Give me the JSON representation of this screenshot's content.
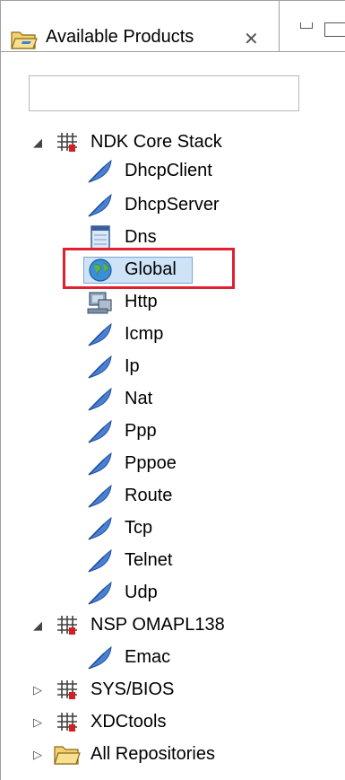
{
  "tab": {
    "title": "Available Products",
    "close_glyph": "✕",
    "icon": "folder-open-icon"
  },
  "view_controls": {
    "minimize_icon": "minimize-icon",
    "maximize_icon": "maximize-icon"
  },
  "search": {
    "placeholder": "",
    "value": ""
  },
  "tree": [
    {
      "label": "NDK Core Stack",
      "expanded": true,
      "icon": "package-icon",
      "children": [
        {
          "label": "DhcpClient",
          "icon": "feather-icon"
        },
        {
          "label": "DhcpServer",
          "icon": "feather-icon"
        },
        {
          "label": "Dns",
          "icon": "document-icon"
        },
        {
          "label": "Global",
          "icon": "globe-icon",
          "selected": true
        },
        {
          "label": "Http",
          "icon": "network-computer-icon"
        },
        {
          "label": "Icmp",
          "icon": "feather-icon"
        },
        {
          "label": "Ip",
          "icon": "feather-icon"
        },
        {
          "label": "Nat",
          "icon": "feather-icon"
        },
        {
          "label": "Ppp",
          "icon": "feather-icon"
        },
        {
          "label": "Pppoe",
          "icon": "feather-icon"
        },
        {
          "label": "Route",
          "icon": "feather-icon"
        },
        {
          "label": "Tcp",
          "icon": "feather-icon"
        },
        {
          "label": "Telnet",
          "icon": "feather-icon"
        },
        {
          "label": "Udp",
          "icon": "feather-icon"
        }
      ]
    },
    {
      "label": "NSP OMAPL138",
      "expanded": true,
      "icon": "package-icon",
      "children": [
        {
          "label": "Emac",
          "icon": "feather-icon"
        }
      ]
    },
    {
      "label": "SYS/BIOS",
      "expanded": false,
      "icon": "package-icon"
    },
    {
      "label": "XDCtools",
      "expanded": false,
      "icon": "package-icon"
    },
    {
      "label": "All Repositories",
      "expanded": false,
      "icon": "folder-icon"
    }
  ],
  "colors": {
    "selection_highlight": "#cfe3f6",
    "annotation_box": "#e0202e",
    "feather_blue": "#3f72c9"
  }
}
